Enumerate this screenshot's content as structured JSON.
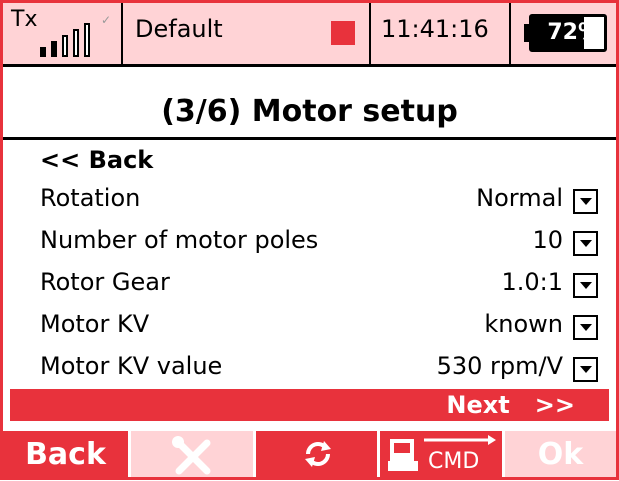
{
  "status_bar": {
    "tx_label": "Tx",
    "signal_bars_filled": 2,
    "signal_bars_total": 5,
    "model_name": "Default",
    "time": "11:41:16",
    "battery_percent": "72%",
    "battery_level": 0.72
  },
  "title": "(3/6) Motor setup",
  "back_link": "<< Back",
  "rows": [
    {
      "label": "Rotation",
      "value": "Normal"
    },
    {
      "label": "Number of motor poles",
      "value": "10"
    },
    {
      "label": "Rotor Gear",
      "value": "1.0:1"
    },
    {
      "label": "Motor KV",
      "value": "known"
    },
    {
      "label": "Motor KV value",
      "value": "530 rpm/V"
    }
  ],
  "next_label": "Next   >>",
  "buttons": {
    "back": "Back",
    "tools_icon": "tools-icon",
    "refresh_icon": "refresh-icon",
    "cmd_icon": "cmd-icon",
    "cmd_text": "CMD",
    "ok": "Ok"
  },
  "colors": {
    "accent_red": "#e8323c",
    "light_pink": "#ffd3d6"
  }
}
